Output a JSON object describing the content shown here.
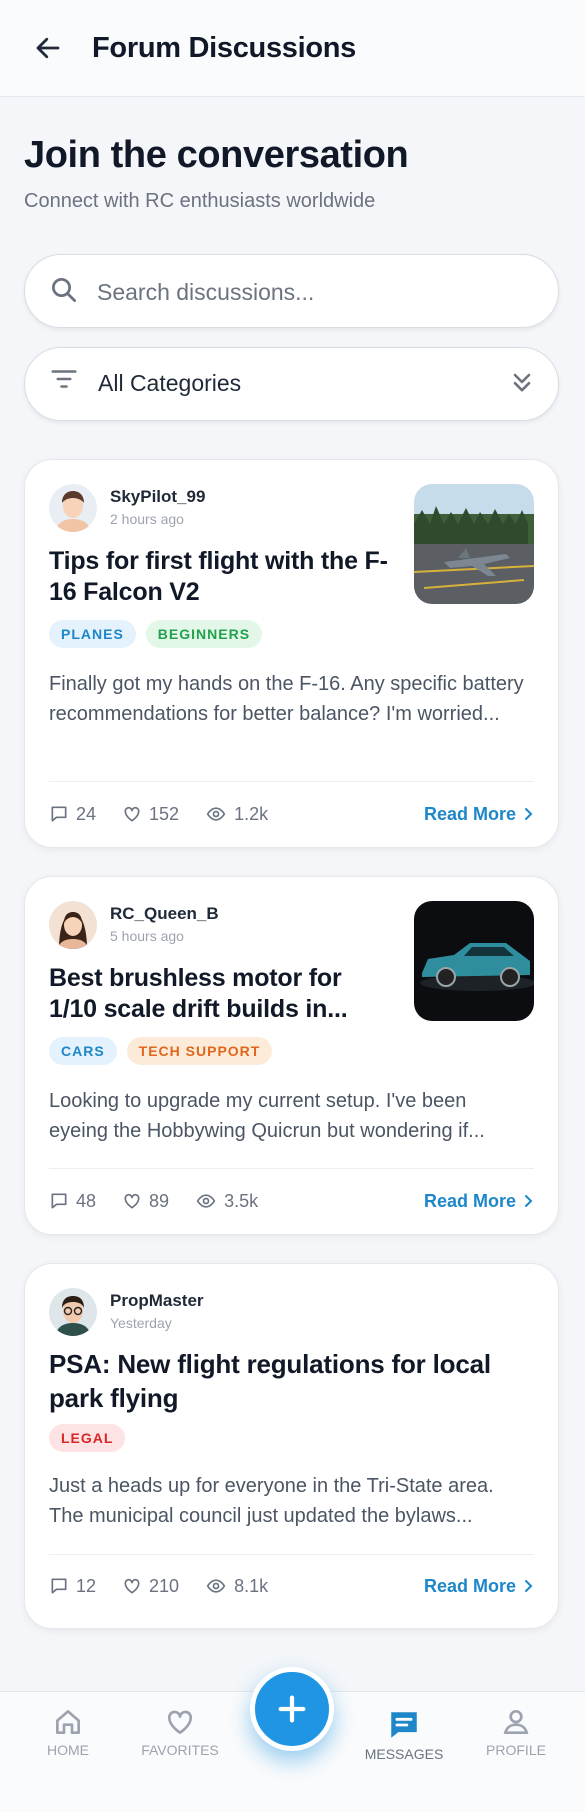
{
  "appbar": {
    "title": "Forum Discussions",
    "back_icon": "arrow-left-icon"
  },
  "hero": {
    "title": "Join the conversation",
    "subtitle": "Connect with RC enthusiasts worldwide"
  },
  "search": {
    "placeholder": "Search discussions...",
    "value": ""
  },
  "category_filter": {
    "selected": "All Categories"
  },
  "posts": [
    {
      "author": "SkyPilot_99",
      "time": "2 hours ago",
      "title": "Tips for first flight with the F-16 Falcon V2",
      "tags": [
        "PLANES",
        "BEGINNERS"
      ],
      "excerpt": "Finally got my hands on the F-16. Any specific battery\nrecommendations for better balance? I'm worried...",
      "comments": "24",
      "likes": "152",
      "views": "1.2k",
      "read_more": "Read More"
    },
    {
      "author": "RC_Queen_B",
      "time": "5 hours ago",
      "title": "Best brushless motor for 1/10 scale drift builds in...",
      "tags": [
        "CARS",
        "TECH SUPPORT"
      ],
      "excerpt": "Looking to upgrade my current setup. I've been eyeing the Hobbywing Quicrun but wondering if...",
      "comments": "48",
      "likes": "89",
      "views": "3.5k",
      "read_more": "Read More"
    },
    {
      "author": "PropMaster",
      "time": "Yesterday",
      "title": "PSA: New flight regulations for local park flying",
      "tags": [
        "LEGAL"
      ],
      "excerpt": "Just a heads up for everyone in the Tri-State area. The municipal council just updated the bylaws...",
      "comments": "12",
      "likes": "210",
      "views": "8.1k",
      "read_more": "Read More"
    }
  ],
  "bottom_nav": {
    "home": "HOME",
    "favorites": "FAVORITES",
    "messages": "MESSAGES",
    "profile": "PROFILE"
  },
  "colors": {
    "accent": "#1f95e3",
    "link": "#1d87c9",
    "tag_planes": "#1d87c9",
    "tag_beginners": "#22a14c",
    "tag_tech_support": "#e0661c",
    "tag_legal": "#dc2626"
  }
}
